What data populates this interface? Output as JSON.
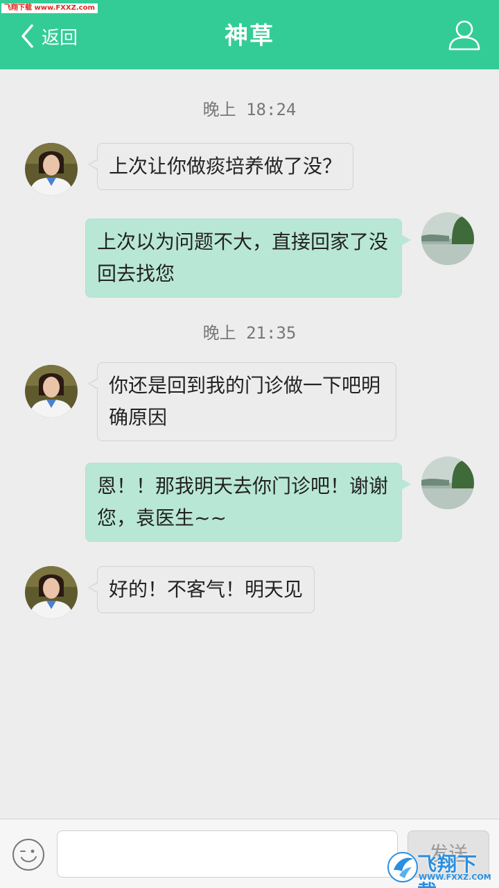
{
  "watermark_top": "飞翔下载 www.FXXZ.com",
  "header": {
    "back_label": "返回",
    "title": "神草",
    "accent": "#34cc96"
  },
  "messages": [
    {
      "type": "time",
      "prefix": "晚上",
      "time": "18:24"
    },
    {
      "type": "received",
      "text": "上次让你做痰培养做了没？"
    },
    {
      "type": "sent",
      "text": "上次以为问题不大，直接回家了没回去找您"
    },
    {
      "type": "time",
      "prefix": "晚上",
      "time": "21:35"
    },
    {
      "type": "received",
      "text": "你还是回到我的门诊做一下吧明确原因"
    },
    {
      "type": "sent",
      "text": "恩！！那我明天去你门诊吧！谢谢您，袁医生~~"
    },
    {
      "type": "received",
      "text": "好的！不客气！明天见"
    }
  ],
  "composer": {
    "value": "",
    "placeholder": "",
    "send_label": "发送"
  },
  "watermark_logo": {
    "text": "飞翔下载",
    "url": "WWW.FXXZ.COM"
  },
  "icons": {
    "back": "chevron-left-icon",
    "profile": "user-icon",
    "emoji": "smiley-icon"
  }
}
